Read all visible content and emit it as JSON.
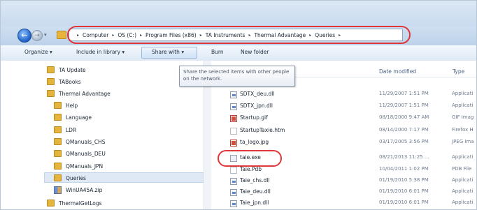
{
  "window": {
    "accent": "#cfdff1",
    "highlight_color": "#e0373a"
  },
  "address": {
    "recent_icon": "chevron-down-icon",
    "crumbs": [
      "Computer",
      "OS (C:)",
      "Program Files (x86)",
      "TA Instruments",
      "Thermal Advantage",
      "Queries"
    ],
    "separator": "▸"
  },
  "toolbar": {
    "organize": "Organize ▾",
    "include": "Include in library ▾",
    "share": "Share with ▾",
    "burn": "Burn",
    "new_folder": "New folder"
  },
  "tooltip": {
    "text": "Share the selected items with other people on the network."
  },
  "nav": {
    "items": [
      {
        "label": "TA Update",
        "icon": "folder-icon"
      },
      {
        "label": "TABooks",
        "icon": "folder-icon"
      },
      {
        "label": "Thermal Advantage",
        "icon": "folder-icon"
      },
      {
        "label": "Help",
        "icon": "folder-icon"
      },
      {
        "label": "Language",
        "icon": "folder-icon"
      },
      {
        "label": "LDR",
        "icon": "folder-icon"
      },
      {
        "label": "QManuals_CHS",
        "icon": "folder-icon"
      },
      {
        "label": "QManuals_DEU",
        "icon": "folder-icon"
      },
      {
        "label": "QManuals_JPN",
        "icon": "folder-icon"
      },
      {
        "label": "Queries",
        "icon": "folder-icon",
        "selected": true
      },
      {
        "label": "WinUA45A.zip",
        "icon": "zip-icon"
      },
      {
        "label": "ThermalGetLogs",
        "icon": "folder-icon"
      }
    ]
  },
  "files": {
    "headers": {
      "date": "Date modified",
      "type": "Type"
    },
    "rows": [
      {
        "name": "SDTX_deu.dll",
        "date": "11/29/2007 1:51 PM",
        "type": "Applicati",
        "icon": "dll-icon"
      },
      {
        "name": "SDTX_jpn.dll",
        "date": "11/29/2007 1:51 PM",
        "type": "Applicati",
        "icon": "dll-icon"
      },
      {
        "name": "Startup.gif",
        "date": "08/18/2000 9:47 AM",
        "type": "GIF Imag",
        "icon": "image-icon"
      },
      {
        "name": "StartupTaxie.htm",
        "date": "08/14/2000 7:17 PM",
        "type": "Firefox H",
        "icon": "html-icon"
      },
      {
        "name": "ta_logo.jpg",
        "date": "03/17/2005 3:56 PM",
        "type": "JPEG Ima",
        "icon": "image-icon"
      },
      {
        "name": "taie.exe",
        "date": "08/21/2013 11:25 ...",
        "type": "Applicati",
        "icon": "exe-icon"
      },
      {
        "name": "Taie.Pdb",
        "date": "10/04/2011 1:02 PM",
        "type": "PDB File",
        "icon": "pdb-icon"
      },
      {
        "name": "Taie_chs.dll",
        "date": "01/19/2010 5:38 PM",
        "type": "Applicati",
        "icon": "dll-icon"
      },
      {
        "name": "Taie_deu.dll",
        "date": "01/19/2010 6:01 PM",
        "type": "Applicati",
        "icon": "dll-icon"
      },
      {
        "name": "Taie_jpn.dll",
        "date": "01/19/2010 6:01 PM",
        "type": "Applicati",
        "icon": "dll-icon"
      }
    ]
  }
}
